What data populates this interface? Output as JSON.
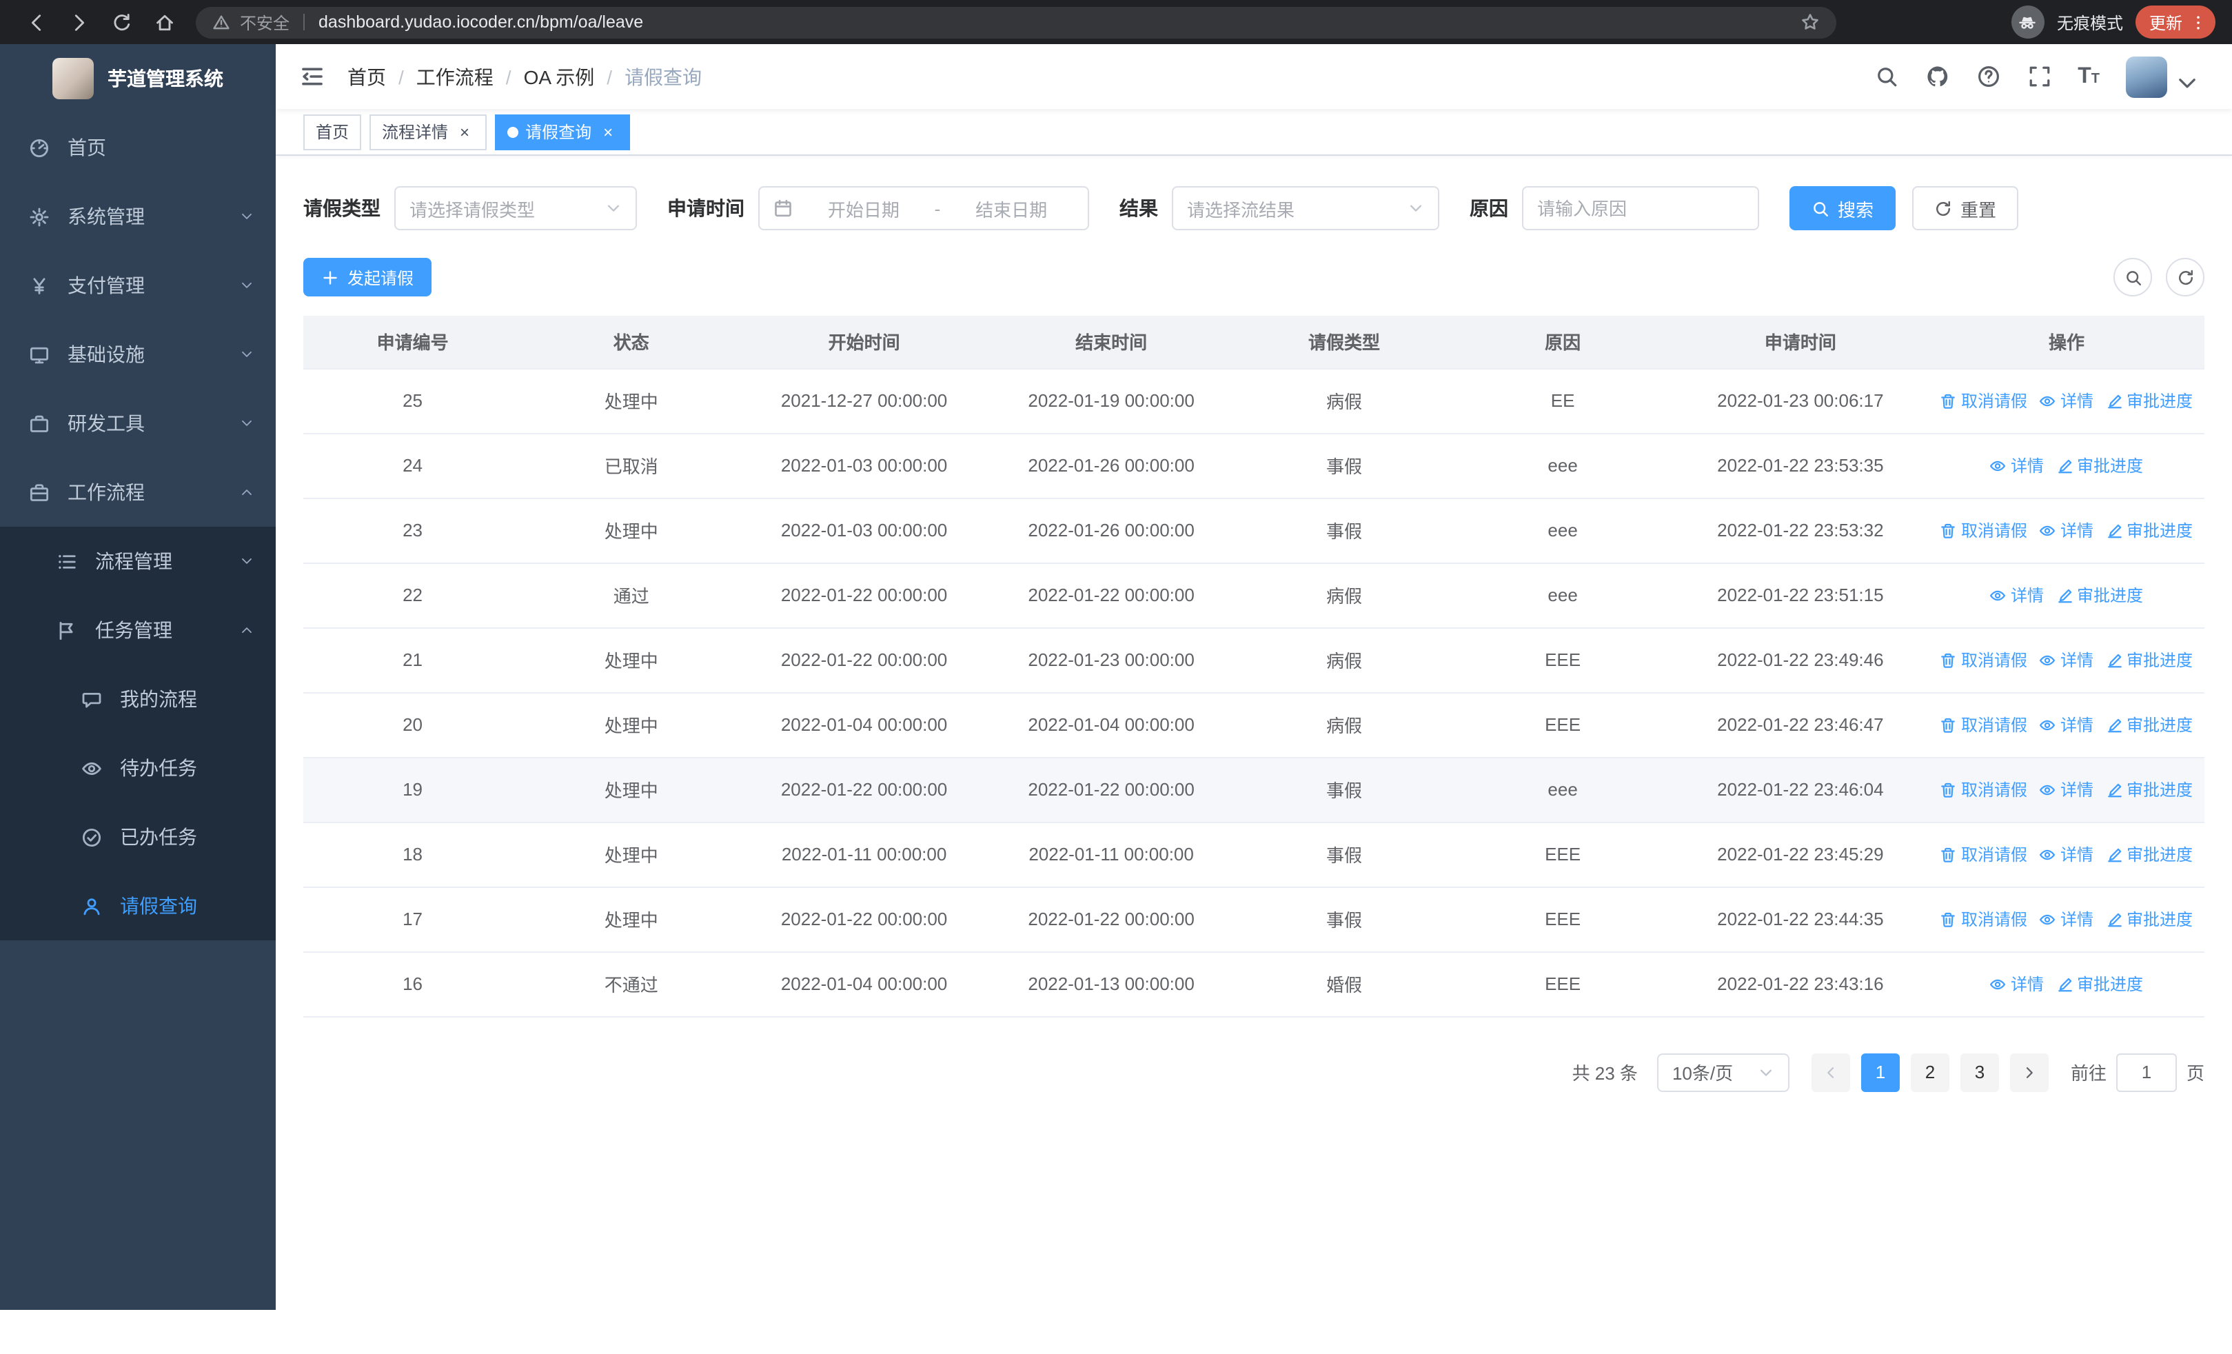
{
  "browser": {
    "url": "dashboard.yudao.iocoder.cn/bpm/oa/leave",
    "security_label": "不安全",
    "incognito_label": "无痕模式",
    "update_label": "更新"
  },
  "sidebar": {
    "app_title": "芋道管理系统",
    "items": [
      {
        "key": "home",
        "label": "首页",
        "icon": "dashboard",
        "level": 1,
        "expandable": false,
        "expanded": false,
        "active": false
      },
      {
        "key": "system-management",
        "label": "系统管理",
        "icon": "gear",
        "level": 1,
        "expandable": true,
        "expanded": false,
        "active": false
      },
      {
        "key": "payment-management",
        "label": "支付管理",
        "icon": "yen",
        "level": 1,
        "expandable": true,
        "expanded": false,
        "active": false
      },
      {
        "key": "infrastructure",
        "label": "基础设施",
        "icon": "monitor",
        "level": 1,
        "expandable": true,
        "expanded": false,
        "active": false
      },
      {
        "key": "devtools",
        "label": "研发工具",
        "icon": "briefcase",
        "level": 1,
        "expandable": true,
        "expanded": false,
        "active": false
      },
      {
        "key": "workflow",
        "label": "工作流程",
        "icon": "suitcase",
        "level": 1,
        "expandable": true,
        "expanded": true,
        "active": false
      },
      {
        "key": "process-management",
        "label": "流程管理",
        "icon": "list",
        "level": 2,
        "expandable": true,
        "expanded": false,
        "active": false
      },
      {
        "key": "task-management",
        "label": "任务管理",
        "icon": "flag",
        "level": 2,
        "expandable": true,
        "expanded": true,
        "active": false
      },
      {
        "key": "my-process",
        "label": "我的流程",
        "icon": "chat",
        "level": 3,
        "expandable": false,
        "expanded": false,
        "active": false
      },
      {
        "key": "todo-tasks",
        "label": "待办任务",
        "icon": "eye",
        "level": 3,
        "expandable": false,
        "expanded": false,
        "active": false
      },
      {
        "key": "done-tasks",
        "label": "已办任务",
        "icon": "check-circle",
        "level": 3,
        "expandable": false,
        "expanded": false,
        "active": false
      },
      {
        "key": "leave-query",
        "label": "请假查询",
        "icon": "user",
        "level": 3,
        "expandable": false,
        "expanded": false,
        "active": true
      }
    ]
  },
  "breadcrumb": [
    "首页",
    "工作流程",
    "OA 示例",
    "请假查询"
  ],
  "tabs": [
    {
      "key": "home",
      "label": "首页",
      "closable": false,
      "active": false
    },
    {
      "key": "process-detail",
      "label": "流程详情",
      "closable": true,
      "active": false
    },
    {
      "key": "leave-query",
      "label": "请假查询",
      "closable": true,
      "active": true
    }
  ],
  "filters": {
    "type_label": "请假类型",
    "type_placeholder": "请选择请假类型",
    "time_label": "申请时间",
    "start_placeholder": "开始日期",
    "range_separator": "-",
    "end_placeholder": "结束日期",
    "result_label": "结果",
    "result_placeholder": "请选择流结果",
    "reason_label": "原因",
    "reason_placeholder": "请输入原因",
    "search_label": "搜索",
    "reset_label": "重置"
  },
  "toolbar": {
    "create_label": "发起请假"
  },
  "table": {
    "columns": [
      "申请编号",
      "状态",
      "开始时间",
      "结束时间",
      "请假类型",
      "原因",
      "申请时间",
      "操作"
    ],
    "actions": {
      "cancel": "取消请假",
      "detail": "详情",
      "progress": "审批进度"
    },
    "rows": [
      {
        "id": "25",
        "status": "处理中",
        "start": "2021-12-27 00:00:00",
        "end": "2022-01-19 00:00:00",
        "type": "病假",
        "reason": "EE",
        "applied": "2022-01-23 00:06:17",
        "actions": [
          "cancel",
          "detail",
          "progress"
        ],
        "hovered": false
      },
      {
        "id": "24",
        "status": "已取消",
        "start": "2022-01-03 00:00:00",
        "end": "2022-01-26 00:00:00",
        "type": "事假",
        "reason": "eee",
        "applied": "2022-01-22 23:53:35",
        "actions": [
          "detail",
          "progress"
        ],
        "hovered": false
      },
      {
        "id": "23",
        "status": "处理中",
        "start": "2022-01-03 00:00:00",
        "end": "2022-01-26 00:00:00",
        "type": "事假",
        "reason": "eee",
        "applied": "2022-01-22 23:53:32",
        "actions": [
          "cancel",
          "detail",
          "progress"
        ],
        "hovered": false
      },
      {
        "id": "22",
        "status": "通过",
        "start": "2022-01-22 00:00:00",
        "end": "2022-01-22 00:00:00",
        "type": "病假",
        "reason": "eee",
        "applied": "2022-01-22 23:51:15",
        "actions": [
          "detail",
          "progress"
        ],
        "hovered": false
      },
      {
        "id": "21",
        "status": "处理中",
        "start": "2022-01-22 00:00:00",
        "end": "2022-01-23 00:00:00",
        "type": "病假",
        "reason": "EEE",
        "applied": "2022-01-22 23:49:46",
        "actions": [
          "cancel",
          "detail",
          "progress"
        ],
        "hovered": false
      },
      {
        "id": "20",
        "status": "处理中",
        "start": "2022-01-04 00:00:00",
        "end": "2022-01-04 00:00:00",
        "type": "病假",
        "reason": "EEE",
        "applied": "2022-01-22 23:46:47",
        "actions": [
          "cancel",
          "detail",
          "progress"
        ],
        "hovered": false
      },
      {
        "id": "19",
        "status": "处理中",
        "start": "2022-01-22 00:00:00",
        "end": "2022-01-22 00:00:00",
        "type": "事假",
        "reason": "eee",
        "applied": "2022-01-22 23:46:04",
        "actions": [
          "cancel",
          "detail",
          "progress"
        ],
        "hovered": true
      },
      {
        "id": "18",
        "status": "处理中",
        "start": "2022-01-11 00:00:00",
        "end": "2022-01-11 00:00:00",
        "type": "事假",
        "reason": "EEE",
        "applied": "2022-01-22 23:45:29",
        "actions": [
          "cancel",
          "detail",
          "progress"
        ],
        "hovered": false
      },
      {
        "id": "17",
        "status": "处理中",
        "start": "2022-01-22 00:00:00",
        "end": "2022-01-22 00:00:00",
        "type": "事假",
        "reason": "EEE",
        "applied": "2022-01-22 23:44:35",
        "actions": [
          "cancel",
          "detail",
          "progress"
        ],
        "hovered": false
      },
      {
        "id": "16",
        "status": "不通过",
        "start": "2022-01-04 00:00:00",
        "end": "2022-01-13 00:00:00",
        "type": "婚假",
        "reason": "EEE",
        "applied": "2022-01-22 23:43:16",
        "actions": [
          "detail",
          "progress"
        ],
        "hovered": false
      }
    ]
  },
  "pagination": {
    "total_label": "共 23 条",
    "page_size": "10条/页",
    "pages": [
      "1",
      "2",
      "3"
    ],
    "active_page": "1",
    "prev_disabled": true,
    "goto_label": "前往",
    "goto_value": "1",
    "page_suffix": "页"
  },
  "colors": {
    "primary": "#409eff",
    "sidebar_bg": "#304156",
    "submenu_bg": "#1f2d3d",
    "update_badge": "#d65745",
    "chrome_bg": "#202124"
  }
}
